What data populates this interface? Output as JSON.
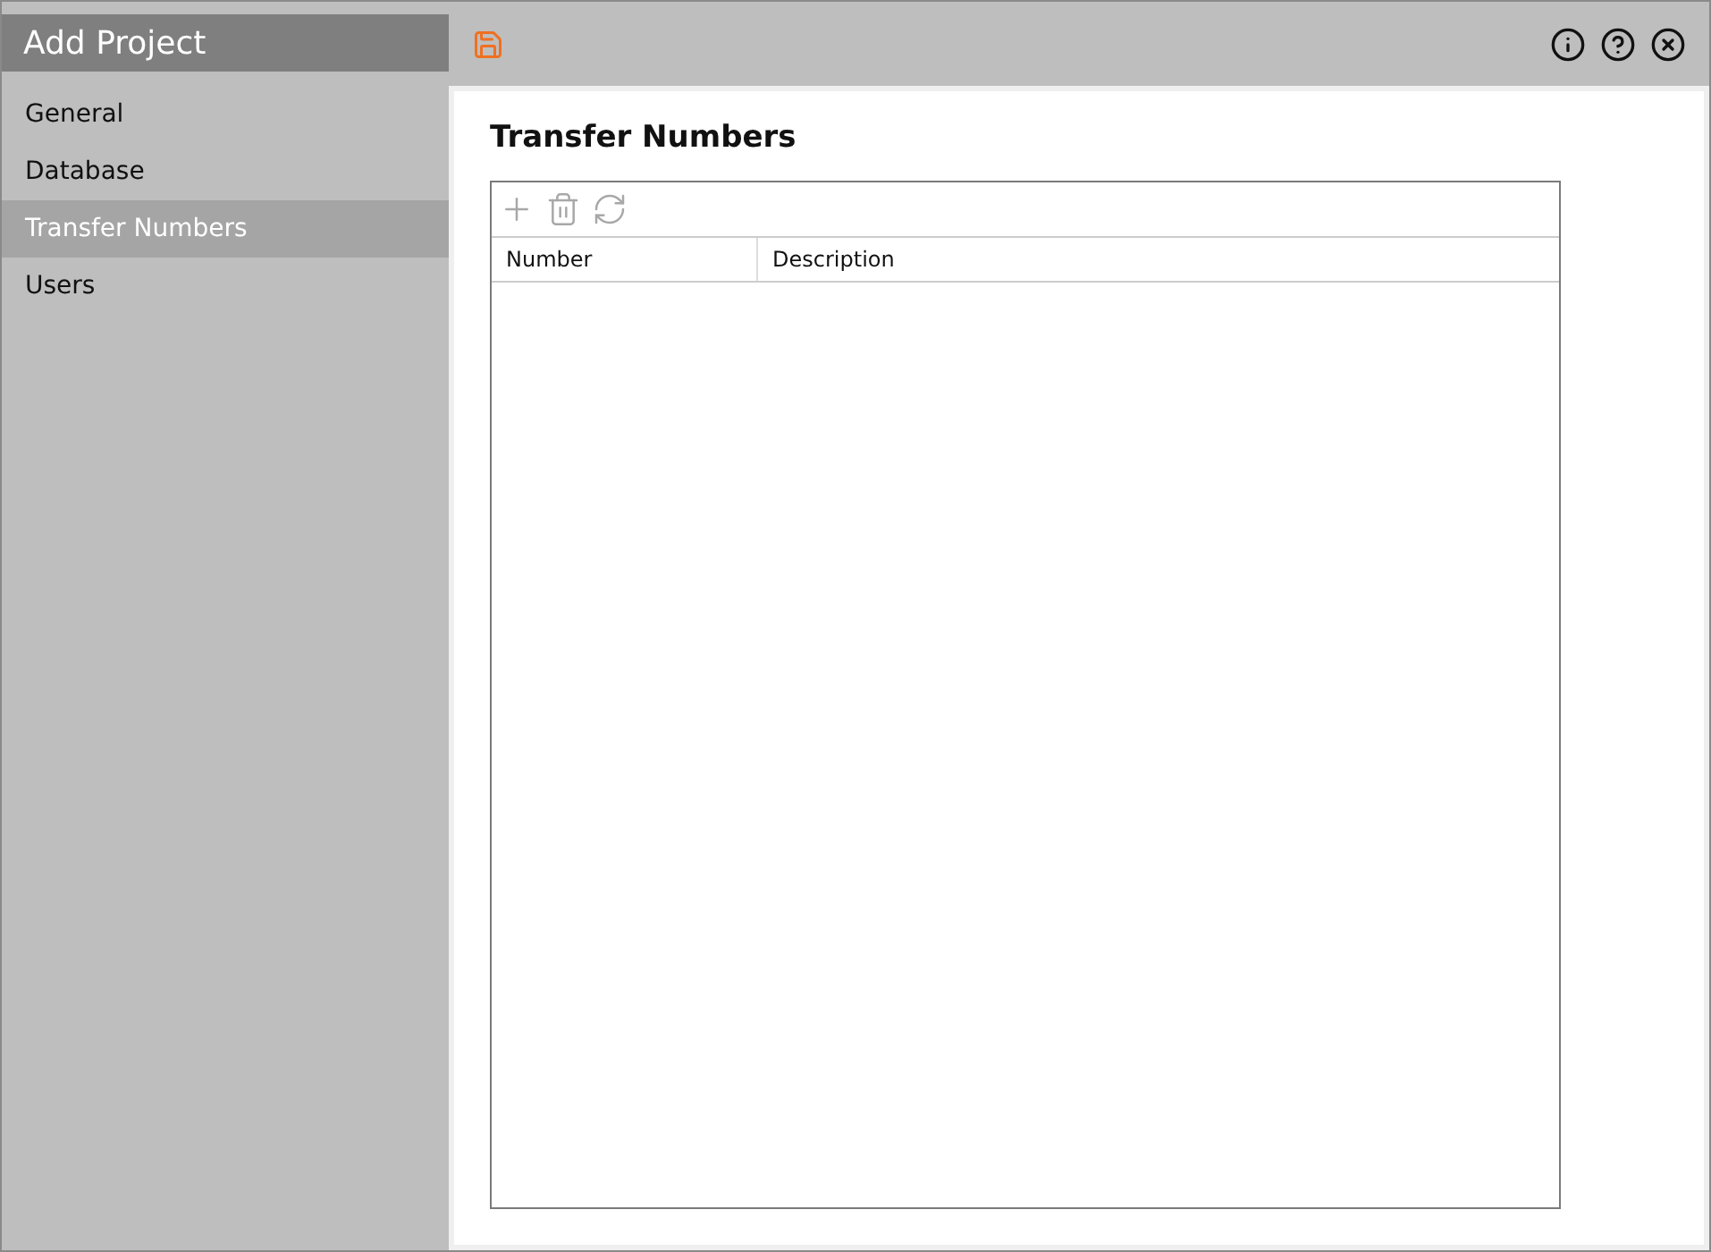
{
  "window": {
    "title": "Add Project"
  },
  "sidebar": {
    "items": [
      {
        "label": "General",
        "selected": false
      },
      {
        "label": "Database",
        "selected": false
      },
      {
        "label": "Transfer Numbers",
        "selected": true
      },
      {
        "label": "Users",
        "selected": false
      }
    ]
  },
  "toolbar": {
    "buttons": [
      {
        "kind": "save",
        "disabled": false
      }
    ],
    "window_buttons": [
      {
        "kind": "info"
      },
      {
        "kind": "help"
      },
      {
        "kind": "close"
      }
    ]
  },
  "content": {
    "heading": "Transfer Numbers",
    "grid_toolbar": [
      {
        "kind": "add",
        "disabled": true
      },
      {
        "kind": "delete",
        "disabled": true
      },
      {
        "kind": "refresh",
        "disabled": true
      }
    ],
    "table": {
      "columns": [
        "Number",
        "Description"
      ]
    }
  }
}
